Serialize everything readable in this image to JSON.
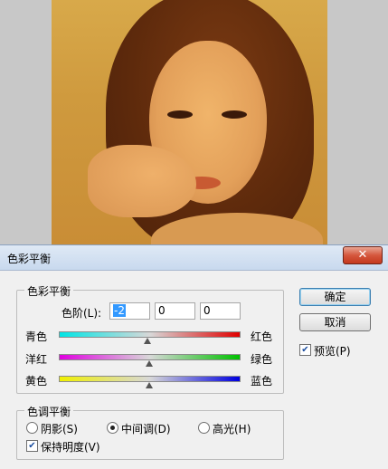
{
  "dialog": {
    "title": "色彩平衡",
    "close_glyph": "✕"
  },
  "color_balance": {
    "legend": "色彩平衡",
    "levels_label": "色阶(L):",
    "levels": [
      "-2",
      "0",
      "0"
    ],
    "sliders": [
      {
        "left": "青色",
        "right": "红色",
        "colors": [
          "#00e5e5",
          "#e00000"
        ],
        "value": -2
      },
      {
        "left": "洋红",
        "right": "绿色",
        "colors": [
          "#e000e0",
          "#00c000"
        ],
        "value": 0
      },
      {
        "left": "黄色",
        "right": "蓝色",
        "colors": [
          "#f0f000",
          "#0000e0"
        ],
        "value": 0
      }
    ]
  },
  "tone_balance": {
    "legend": "色调平衡",
    "shadows": "阴影(S)",
    "midtones": "中间调(D)",
    "highlights": "高光(H)",
    "selected": "midtones",
    "preserve_luminosity": "保持明度(V)",
    "preserve_checked": true
  },
  "buttons": {
    "ok": "确定",
    "cancel": "取消"
  },
  "preview": {
    "label": "预览(P)",
    "checked": true
  },
  "check_glyph": "✔"
}
